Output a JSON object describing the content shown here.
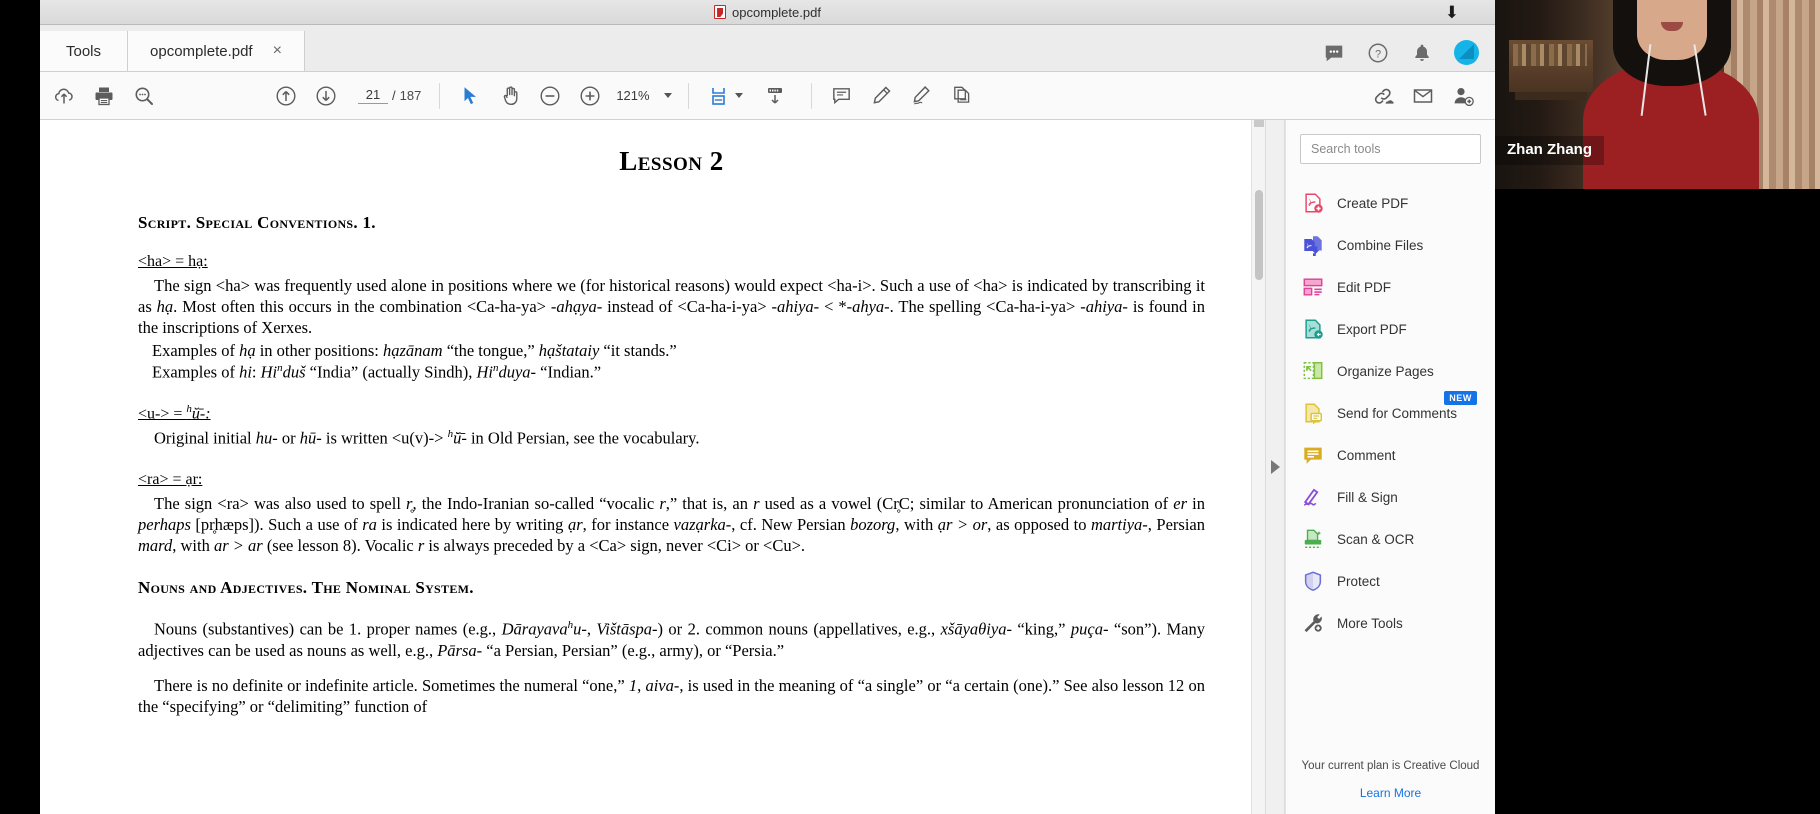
{
  "window": {
    "title": "opcomplete.pdf",
    "download_icon": "download-arrow-icon"
  },
  "tabs": {
    "tools_label": "Tools",
    "document_label": "opcomplete.pdf",
    "close_label": "×",
    "right_icons": [
      "chat-bubble-icon",
      "help-circle-icon",
      "bell-icon",
      "account-avatar"
    ]
  },
  "toolbar": {
    "page_current": "21",
    "page_separator": "/",
    "page_total": "187",
    "zoom_level": "121%",
    "icons": [
      "cloud-upload-icon",
      "print-icon",
      "search-icon",
      "previous-page-icon",
      "next-page-icon",
      "select-cursor-icon",
      "hand-tool-icon",
      "zoom-out-icon",
      "zoom-in-icon",
      "fit-page-icon",
      "scroll-mode-icon",
      "comment-icon",
      "highlight-icon",
      "sign-icon",
      "stamp-icon",
      "share-link-icon",
      "email-icon",
      "add-person-icon"
    ]
  },
  "document": {
    "title": "Lesson 2",
    "section1_heading": "Script.   Special Conventions.  1.",
    "sub1_heading": "<ha> = hạ:",
    "para1_a": "The sign <ha> was frequently used alone in positions where we (for historical reasons) would expect <ha-i>.  Such a use of <ha> is indicated by transcribing it as ",
    "para1_ha": "hạ",
    "para1_b": ".  Most often this occurs in the combination <Ca-ha-ya> ",
    "para1_ahaya": "-ahạya-",
    "para1_c": " instead of <Ca-ha-i-ya> ",
    "para1_ahiya": "-ahiya-",
    "para1_d": " < *",
    "para1_ahya": "-ahya-",
    "para1_e": ".   The spelling <Ca-ha-i-ya> ",
    "para1_ahiya2": "-ahiya-",
    "para1_f": " is found in the inscriptions of Xerxes.",
    "ex1_pre": "Examples of ",
    "ex1_ha": "hạ",
    "ex1_mid": " in other positions: ",
    "ex1_w1": "hạzānam",
    "ex1_g1": " “the tongue,” ",
    "ex1_w2": "hạštataiy",
    "ex1_g2": " “it stands.”",
    "ex2_pre": "Examples of ",
    "ex2_hi": "hi",
    "ex2_mid": ": ",
    "ex2_w1": "Hi",
    "ex2_w1sup": "n",
    "ex2_w1b": "duš",
    "ex2_g1": " “India” (actually Sindh),  ",
    "ex2_w2": "Hi",
    "ex2_w2sup": "n",
    "ex2_w2b": "duya-",
    "ex2_g2": " “Indian.”",
    "sub2_heading_a": "<u-> = ",
    "sub2_heading_sup": "h",
    "sub2_heading_b": "ŭ̄-:",
    "para2_a": "Original initial ",
    "para2_hu": "hu-",
    "para2_b": " or ",
    "para2_hu2": "hū-",
    "para2_c": " is written <u(v)-> ",
    "para2_sup": "h",
    "para2_d": "ŭ̄-",
    "para2_e": " in Old Persian, see the vocabulary.",
    "sub3_heading": "<ra> = ạr:",
    "para3_a": "The sign <ra> was also used to spell ",
    "para3_r": "r̥",
    "para3_b": ", the Indo-Iranian so-called “vocalic ",
    "para3_r2": "r",
    "para3_c": ",” that is, an ",
    "para3_r3": "r",
    "para3_d": " used as a vowel (Cr̥C; similar to American pronunciation of ",
    "para3_er": "er",
    "para3_e": " in ",
    "para3_perhaps": "perhaps",
    "para3_f": " [pr̥hæps]).  Such a use of ",
    "para3_ra": "ra",
    "para3_g": " is indicated here by writing ",
    "para3_ar": "ạr",
    "para3_h": ", for instance ",
    "para3_vazarka": "vazạrka-",
    "para3_i": ", cf. New Persian ",
    "para3_bozorg": "bozorg",
    "para3_j": ", with ",
    "para3_ar2": "ạr > or",
    "para3_k": ", as opposed to ",
    "para3_martiya": "martiya-",
    "para3_l": ", Persian ",
    "para3_mard": "mard",
    "para3_m": ", with ",
    "para3_ar3": "ar > ar",
    "para3_n": " (see lesson 8).  Vocalic ",
    "para3_r4": "r",
    "para3_o": " is always preceded by a <Ca> sign, never <Ci> or <Cu>.",
    "section2_heading": "Nouns and Adjectives.  The Nominal System.",
    "para4_a": "Nouns (substantives) can be 1. proper names (e.g., ",
    "para4_n1": "Dārayava",
    "para4_n1sup": "h",
    "para4_n1b": "u-",
    "para4_mid": ", ",
    "para4_n2": "Vištāspa-",
    "para4_b": ") or 2. common nouns (appellatives, e.g., ",
    "para4_n3": "xšāyaθiya-",
    "para4_c": " “king,” ",
    "para4_n4": "puça-",
    "para4_d": " “son”).  Many adjectives can be used as nouns as well, e.g., ",
    "para4_n5": "Pārsa-",
    "para4_e": " “a Persian, Persian” (e.g., army), or “Persia.”",
    "para5_a": "There is no definite or indefinite article.  Sometimes the numeral “one,” ",
    "para5_one": "1",
    "para5_b": ", ",
    "para5_aiva": "aiva-",
    "para5_c": ", is used in the meaning of “a single” or “a certain (one).”  See also lesson 12 on the “specifying” or “delimiting” function of"
  },
  "tools_panel": {
    "search_placeholder": "Search tools",
    "items": [
      {
        "label": "Create PDF",
        "icon": "create-pdf-icon",
        "color": "#e8476a"
      },
      {
        "label": "Combine Files",
        "icon": "combine-files-icon",
        "color": "#4a52d8"
      },
      {
        "label": "Edit PDF",
        "icon": "edit-pdf-icon",
        "color": "#e0449a"
      },
      {
        "label": "Export PDF",
        "icon": "export-pdf-icon",
        "color": "#1a9e8f"
      },
      {
        "label": "Organize Pages",
        "icon": "organize-pages-icon",
        "color": "#7fc241"
      },
      {
        "label": "Send for Comments",
        "icon": "send-for-comments-icon",
        "color": "#dcc33c",
        "badge": "NEW"
      },
      {
        "label": "Comment",
        "icon": "comment-icon",
        "color": "#d9ac23"
      },
      {
        "label": "Fill & Sign",
        "icon": "fill-sign-icon",
        "color": "#8a4fd8"
      },
      {
        "label": "Scan & OCR",
        "icon": "scan-ocr-icon",
        "color": "#4bae4f"
      },
      {
        "label": "Protect",
        "icon": "protect-shield-icon",
        "color": "#6b6fd6"
      },
      {
        "label": "More Tools",
        "icon": "more-tools-icon",
        "color": "#5c5c5c"
      }
    ],
    "plan_text": "Your current plan is Creative Cloud",
    "learn_more": "Learn More"
  },
  "webcam": {
    "participant_name": "Zhan Zhang"
  }
}
